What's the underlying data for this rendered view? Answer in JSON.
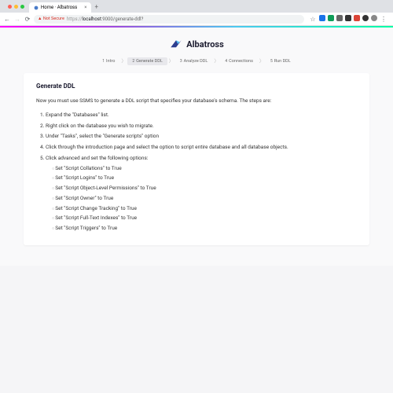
{
  "browser": {
    "tab_title": "Home · Albatross",
    "not_secure": "Not Secure",
    "url_prefix": "https://",
    "url_host": "localhost",
    "url_rest": ":9000/generate-ddl?"
  },
  "brand": "Albatross",
  "steps": [
    {
      "n": "1",
      "label": "Intro"
    },
    {
      "n": "2",
      "label": "Generate DDL"
    },
    {
      "n": "3",
      "label": "Analyze DDL"
    },
    {
      "n": "4",
      "label": "Connections"
    },
    {
      "n": "5",
      "label": "Run DDL"
    }
  ],
  "card": {
    "title": "Generate DDL",
    "intro": "Now you must use SSMS to generate a DDL script that specifies your database's schema. The steps are:",
    "items": [
      "Expand the \"Databases\" list.",
      "Right click on the database you wish to migrate.",
      "Under \"Tasks\", select the \"Generate scripts\" option",
      "Click through the introduction page and select the option to script entire database and all database objects.",
      "Click advanced and set the following options:"
    ],
    "subitems": [
      "Set \"Script Collations\" to True",
      "Set \"Script Logins\" to True",
      "Set \"Script Object-Level Permissions\" to True",
      "Set \"Script Owner\" to True",
      "Set \"Script Change Tracking\" to True",
      "Set \"Script Full-Text Indexes\" to True",
      "Set \"Script Triggers\" to True"
    ]
  }
}
